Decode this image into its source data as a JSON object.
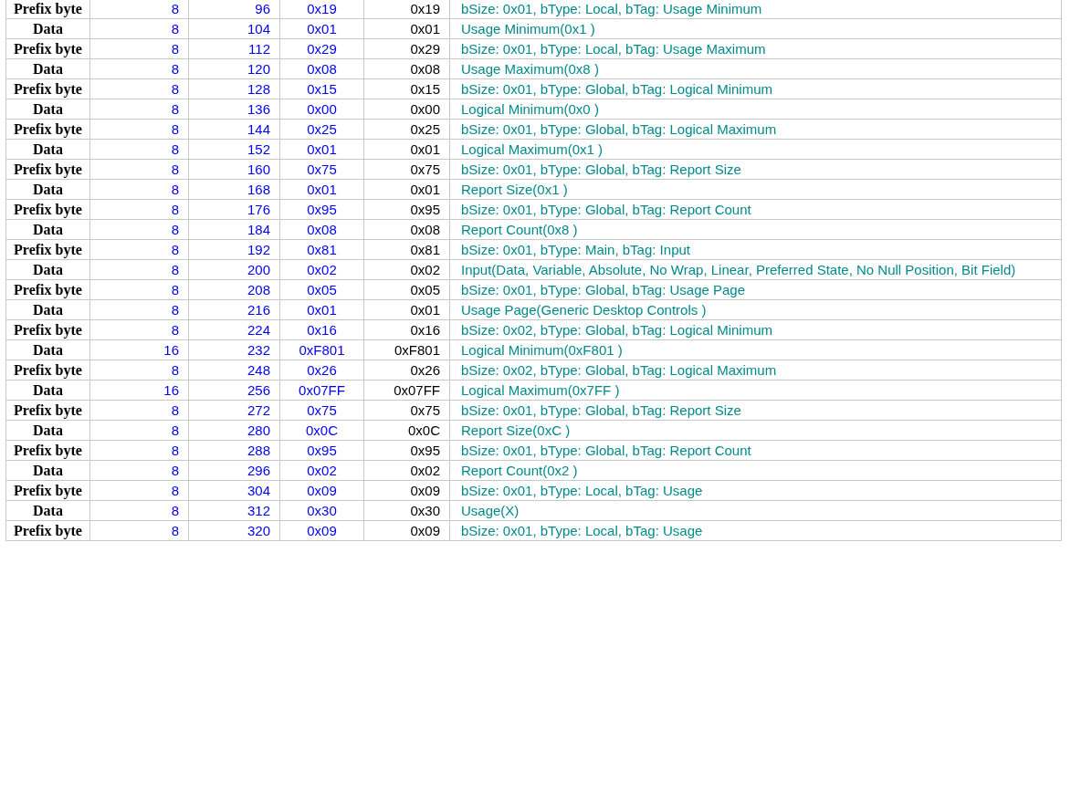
{
  "table": {
    "rows": [
      {
        "cells": [
          "Prefix byte",
          "8",
          "96",
          "0x19",
          "0x19",
          "bSize: 0x01, bType: Local, bTag: Usage Minimum"
        ]
      },
      {
        "cells": [
          "Data",
          "8",
          "104",
          "0x01",
          "0x01",
          "Usage Minimum(0x1 )"
        ]
      },
      {
        "cells": [
          "Prefix byte",
          "8",
          "112",
          "0x29",
          "0x29",
          "bSize: 0x01, bType: Local, bTag: Usage Maximum"
        ]
      },
      {
        "cells": [
          "Data",
          "8",
          "120",
          "0x08",
          "0x08",
          "Usage Maximum(0x8 )"
        ]
      },
      {
        "cells": [
          "Prefix byte",
          "8",
          "128",
          "0x15",
          "0x15",
          "bSize: 0x01, bType: Global, bTag: Logical Minimum"
        ]
      },
      {
        "cells": [
          "Data",
          "8",
          "136",
          "0x00",
          "0x00",
          "Logical Minimum(0x0 )"
        ]
      },
      {
        "cells": [
          "Prefix byte",
          "8",
          "144",
          "0x25",
          "0x25",
          "bSize: 0x01, bType: Global, bTag: Logical Maximum"
        ]
      },
      {
        "cells": [
          "Data",
          "8",
          "152",
          "0x01",
          "0x01",
          "Logical Maximum(0x1 )"
        ]
      },
      {
        "cells": [
          "Prefix byte",
          "8",
          "160",
          "0x75",
          "0x75",
          "bSize: 0x01, bType: Global, bTag: Report Size"
        ]
      },
      {
        "cells": [
          "Data",
          "8",
          "168",
          "0x01",
          "0x01",
          "Report Size(0x1 )"
        ]
      },
      {
        "cells": [
          "Prefix byte",
          "8",
          "176",
          "0x95",
          "0x95",
          "bSize: 0x01, bType: Global, bTag: Report Count"
        ]
      },
      {
        "cells": [
          "Data",
          "8",
          "184",
          "0x08",
          "0x08",
          "Report Count(0x8 )"
        ]
      },
      {
        "cells": [
          "Prefix byte",
          "8",
          "192",
          "0x81",
          "0x81",
          "bSize: 0x01, bType: Main, bTag: Input"
        ]
      },
      {
        "cells": [
          "Data",
          "8",
          "200",
          "0x02",
          "0x02",
          "Input(Data, Variable, Absolute, No Wrap, Linear, Preferred State, No Null Position, Bit Field)"
        ]
      },
      {
        "cells": [
          "Prefix byte",
          "8",
          "208",
          "0x05",
          "0x05",
          "bSize: 0x01, bType: Global, bTag: Usage Page"
        ]
      },
      {
        "cells": [
          "Data",
          "8",
          "216",
          "0x01",
          "0x01",
          "Usage Page(Generic Desktop Controls )"
        ]
      },
      {
        "cells": [
          "Prefix byte",
          "8",
          "224",
          "0x16",
          "0x16",
          "bSize: 0x02, bType: Global, bTag: Logical Minimum"
        ]
      },
      {
        "cells": [
          "Data",
          "16",
          "232",
          "0xF801",
          "0xF801",
          "Logical Minimum(0xF801 )"
        ]
      },
      {
        "cells": [
          "Prefix byte",
          "8",
          "248",
          "0x26",
          "0x26",
          "bSize: 0x02, bType: Global, bTag: Logical Maximum"
        ]
      },
      {
        "cells": [
          "Data",
          "16",
          "256",
          "0x07FF",
          "0x07FF",
          "Logical Maximum(0x7FF )"
        ]
      },
      {
        "cells": [
          "Prefix byte",
          "8",
          "272",
          "0x75",
          "0x75",
          "bSize: 0x01, bType: Global, bTag: Report Size"
        ]
      },
      {
        "cells": [
          "Data",
          "8",
          "280",
          "0x0C",
          "0x0C",
          "Report Size(0xC )"
        ]
      },
      {
        "cells": [
          "Prefix byte",
          "8",
          "288",
          "0x95",
          "0x95",
          "bSize: 0x01, bType: Global, bTag: Report Count"
        ]
      },
      {
        "cells": [
          "Data",
          "8",
          "296",
          "0x02",
          "0x02",
          "Report Count(0x2 )"
        ]
      },
      {
        "cells": [
          "Prefix byte",
          "8",
          "304",
          "0x09",
          "0x09",
          "bSize: 0x01, bType: Local, bTag: Usage"
        ]
      },
      {
        "cells": [
          "Data",
          "8",
          "312",
          "0x30",
          "0x30",
          "Usage(X)"
        ]
      },
      {
        "cells": [
          "Prefix byte",
          "8",
          "320",
          "0x09",
          "0x09",
          "bSize: 0x01, bType: Local, bTag: Usage"
        ]
      }
    ]
  }
}
